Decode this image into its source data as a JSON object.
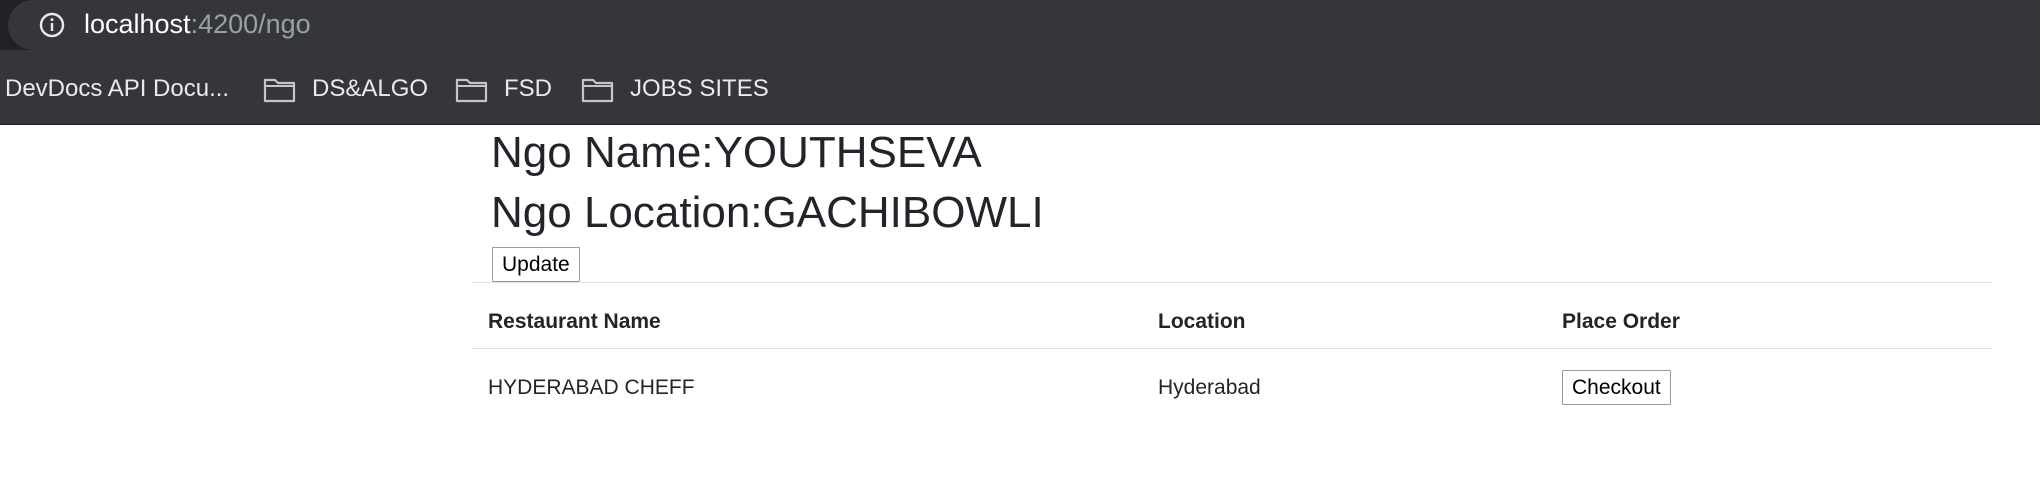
{
  "browser": {
    "url_host": "localhost",
    "url_rest": ":4200/ngo",
    "bookmarks": [
      {
        "label": "DevDocs API Docu...",
        "icon": "none"
      },
      {
        "label": "DS&ALGO",
        "icon": "folder-icon"
      },
      {
        "label": "FSD",
        "icon": "folder-icon"
      },
      {
        "label": "JOBS SITES",
        "icon": "folder-icon"
      }
    ]
  },
  "ngo": {
    "name_line": "Ngo Name:YOUTHSEVA",
    "location_line": "Ngo Location:GACHIBOWLI",
    "update_label": "Update"
  },
  "table": {
    "headers": [
      "Restaurant Name",
      "Location",
      "Place Order"
    ],
    "rows": [
      {
        "restaurant": "HYDERABAD CHEFF",
        "location": "Hyderabad",
        "action_label": "Checkout"
      }
    ]
  },
  "colors": {
    "chrome_dark": "#202124",
    "chrome_bar": "#35363a",
    "text_dark": "#212529",
    "table_rule": "#dee2e6"
  }
}
